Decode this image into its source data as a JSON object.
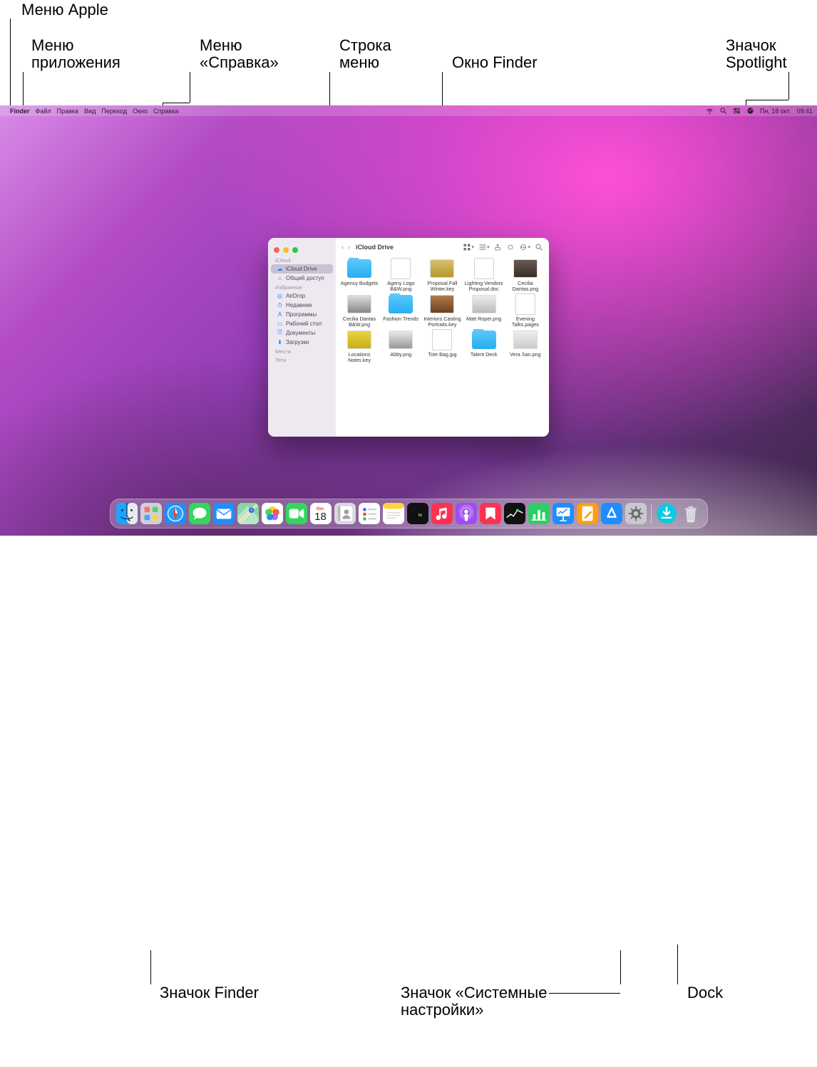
{
  "callouts": {
    "apple_menu": "Меню Apple",
    "app_menu_l1": "Меню",
    "app_menu_l2": "приложения",
    "help_menu_l1": "Меню",
    "help_menu_l2": "«Справка»",
    "menu_bar_l1": "Строка",
    "menu_bar_l2": "меню",
    "finder_window": "Окно Finder",
    "spotlight_l1": "Значок",
    "spotlight_l2": "Spotlight",
    "finder_icon": "Значок Finder",
    "sysprefs_l1": "Значок «Системные",
    "sysprefs_l2": "настройки»",
    "dock": "Dock"
  },
  "menubar": {
    "apple": "",
    "app_name": "Finder",
    "items": [
      "Файл",
      "Правка",
      "Вид",
      "Переход",
      "Окно",
      "Справка"
    ],
    "wifi": "wifi-icon",
    "spotlight": "spotlight-icon",
    "control_center": "control-center-icon",
    "siri": "siri-icon",
    "date": "Пн, 18 окт.",
    "time": "09:41"
  },
  "finder": {
    "title": "iCloud Drive",
    "sidebar": {
      "sections": [
        {
          "name": "iCloud",
          "items": [
            {
              "icon": "cloud-icon",
              "label": "iCloud Drive",
              "selected": true
            },
            {
              "icon": "people-icon",
              "label": "Общий доступ",
              "selected": false
            }
          ]
        },
        {
          "name": "Избранное",
          "items": [
            {
              "icon": "airdrop-icon",
              "label": "AirDrop",
              "selected": false
            },
            {
              "icon": "clock-icon",
              "label": "Недавние",
              "selected": false
            },
            {
              "icon": "apps-icon",
              "label": "Программы",
              "selected": false
            },
            {
              "icon": "desktop-icon",
              "label": "Рабочий стол",
              "selected": false
            },
            {
              "icon": "doc-icon",
              "label": "Документы",
              "selected": false
            },
            {
              "icon": "downloads-icon",
              "label": "Загрузки",
              "selected": false
            }
          ]
        },
        {
          "name": "Места",
          "items": []
        },
        {
          "name": "Теги",
          "items": []
        }
      ]
    },
    "toolbar": {
      "back": "‹",
      "forward": "›",
      "view": "grid-icon",
      "group": "group-icon",
      "share": "share-icon",
      "tag": "tag-icon",
      "action": "action-icon",
      "search": "search-icon"
    },
    "files": [
      {
        "name": "Agency Budgets",
        "type": "folder"
      },
      {
        "name": "Ageny Logo B&W.png",
        "type": "paper"
      },
      {
        "name": "Proposal Fall Winter.key",
        "type": "image",
        "bg": "linear-gradient(#d9c06a,#b59532)"
      },
      {
        "name": "Lighting Vendors Proposal.doc",
        "type": "paper"
      },
      {
        "name": "Cecilia Dantas.png",
        "type": "image",
        "bg": "linear-gradient(#6a5a52,#3a2e28)"
      },
      {
        "name": "Cecilia Dantas B&W.png",
        "type": "image",
        "bg": "linear-gradient(#ddd,#888)"
      },
      {
        "name": "Fashion Trends",
        "type": "folder"
      },
      {
        "name": "Interiors Casting Portraits.key",
        "type": "image",
        "bg": "linear-gradient(#b07b47,#6a4325)"
      },
      {
        "name": "Matt Roper.png",
        "type": "image",
        "bg": "linear-gradient(#eee,#bbb)"
      },
      {
        "name": "Evening Talks.pages",
        "type": "paper"
      },
      {
        "name": "Locations Notes.key",
        "type": "image",
        "bg": "linear-gradient(#e8d440,#caad1a)"
      },
      {
        "name": "Abby.png",
        "type": "image",
        "bg": "linear-gradient(#e9e9e9,#999)"
      },
      {
        "name": "Tote Bag.jpg",
        "type": "paper"
      },
      {
        "name": "Talent Deck",
        "type": "folder"
      },
      {
        "name": "Vera San.png",
        "type": "image",
        "bg": "linear-gradient(#eee,#ccc)"
      }
    ]
  },
  "dock": [
    {
      "name": "finder",
      "bg": "linear-gradient(#19c1ff,#1f77ff)"
    },
    {
      "name": "launchpad",
      "bg": "linear-gradient(#d8d8dc,#b7b7bf)"
    },
    {
      "name": "safari",
      "bg": "linear-gradient(#24b1ff,#0d6ef5)"
    },
    {
      "name": "messages",
      "bg": "linear-gradient(#5ef178,#18c63a)"
    },
    {
      "name": "mail",
      "bg": "linear-gradient(#36b8ff,#1273f3)"
    },
    {
      "name": "maps",
      "bg": "linear-gradient(#cfeedf,#7bcf9e)"
    },
    {
      "name": "photos",
      "bg": "#fff"
    },
    {
      "name": "facetime",
      "bg": "linear-gradient(#5ef178,#18c63a)"
    },
    {
      "name": "calendar",
      "bg": "#fff",
      "text": "18",
      "top": "Окт."
    },
    {
      "name": "contacts",
      "bg": "linear-gradient(#dcdce0,#bcbcc2)"
    },
    {
      "name": "reminders",
      "bg": "#fff"
    },
    {
      "name": "notes",
      "bg": "linear-gradient(#fff,#fff6cf)"
    },
    {
      "name": "tv",
      "bg": "#1c1c1e"
    },
    {
      "name": "music",
      "bg": "linear-gradient(#ff4763,#f61d3a)"
    },
    {
      "name": "podcasts",
      "bg": "linear-gradient(#c06bf7,#8a30e3)"
    },
    {
      "name": "news",
      "bg": "linear-gradient(#ff4763,#f61d3a)"
    },
    {
      "name": "stocks",
      "bg": "#1c1c1e"
    },
    {
      "name": "numbers",
      "bg": "linear-gradient(#34e67a,#14b64d)"
    },
    {
      "name": "keynote",
      "bg": "linear-gradient(#2ca7ff,#0f6ef4)"
    },
    {
      "name": "pages",
      "bg": "linear-gradient(#ffb540,#ff8a00)"
    },
    {
      "name": "appstore",
      "bg": "linear-gradient(#24b1ff,#1273f3)"
    },
    {
      "name": "system-preferences",
      "bg": "linear-gradient(#dcdce0,#9a9aa2)"
    },
    {
      "type": "sep"
    },
    {
      "name": "downloads",
      "bg": "linear-gradient(#15d6e8,#0aa8c4)"
    },
    {
      "name": "trash",
      "bg": "radial-gradient(#f1f1f3,#c4c4ca)"
    }
  ]
}
